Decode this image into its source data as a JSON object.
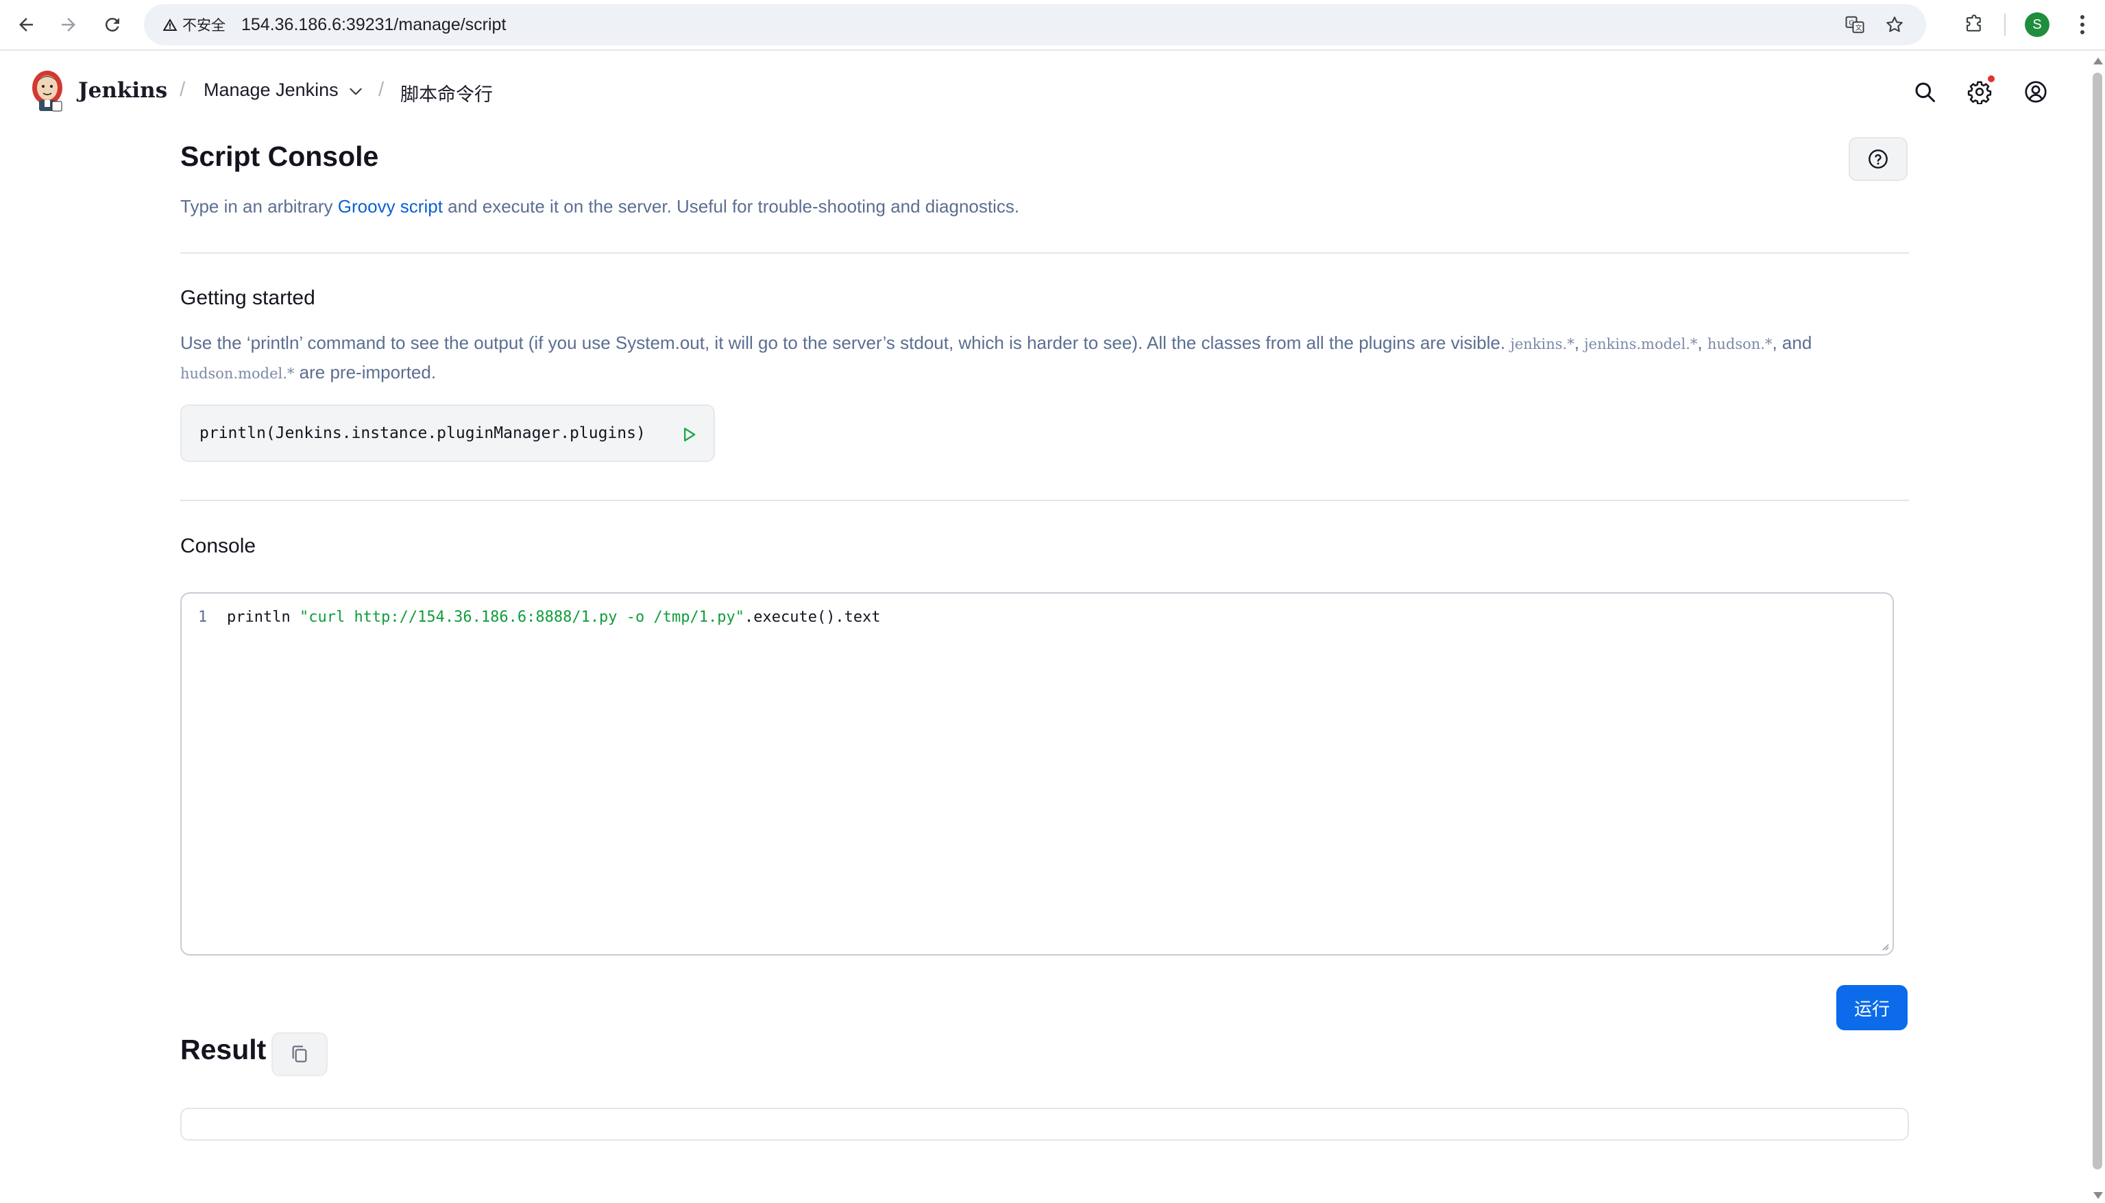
{
  "browser": {
    "security_label": "不安全",
    "url": "154.36.186.6:39231/manage/script",
    "profile_initial": "S"
  },
  "header": {
    "brand": "Jenkins",
    "breadcrumbs": [
      "Manage Jenkins",
      "脚本命令行"
    ],
    "notification_color": "#e5312c"
  },
  "page": {
    "title": "Script Console",
    "desc_before": "Type in an arbitrary ",
    "desc_link": "Groovy script",
    "desc_after": " and execute it on the server. Useful for trouble-shooting and diagnostics."
  },
  "getting_started": {
    "title": "Getting started",
    "text_1": "Use the ‘println’ command to see the output (if you use System.out, it will go to the server’s stdout, which is harder to see). All the classes from all the plugins are visible. ",
    "code_1": "jenkins.*",
    "sep_1": ", ",
    "code_2": "jenkins.model.*",
    "sep_2": ", ",
    "code_3": "hudson.*",
    "sep_3": ", and ",
    "code_4": "hudson.model.*",
    "text_2": " are pre-imported.",
    "snippet": "println(Jenkins.instance.pluginManager.plugins)"
  },
  "console": {
    "title": "Console",
    "line_number": "1",
    "code_prefix": "println ",
    "code_string": "\"curl http://154.36.186.6:8888/1.py -o /tmp/1.py\"",
    "code_suffix": ".execute().text",
    "run_label": "运行"
  },
  "result": {
    "title": "Result",
    "output": ""
  },
  "colors": {
    "accent": "#0b6bea",
    "link": "#0b5fd9",
    "string": "#0f9d3a"
  }
}
